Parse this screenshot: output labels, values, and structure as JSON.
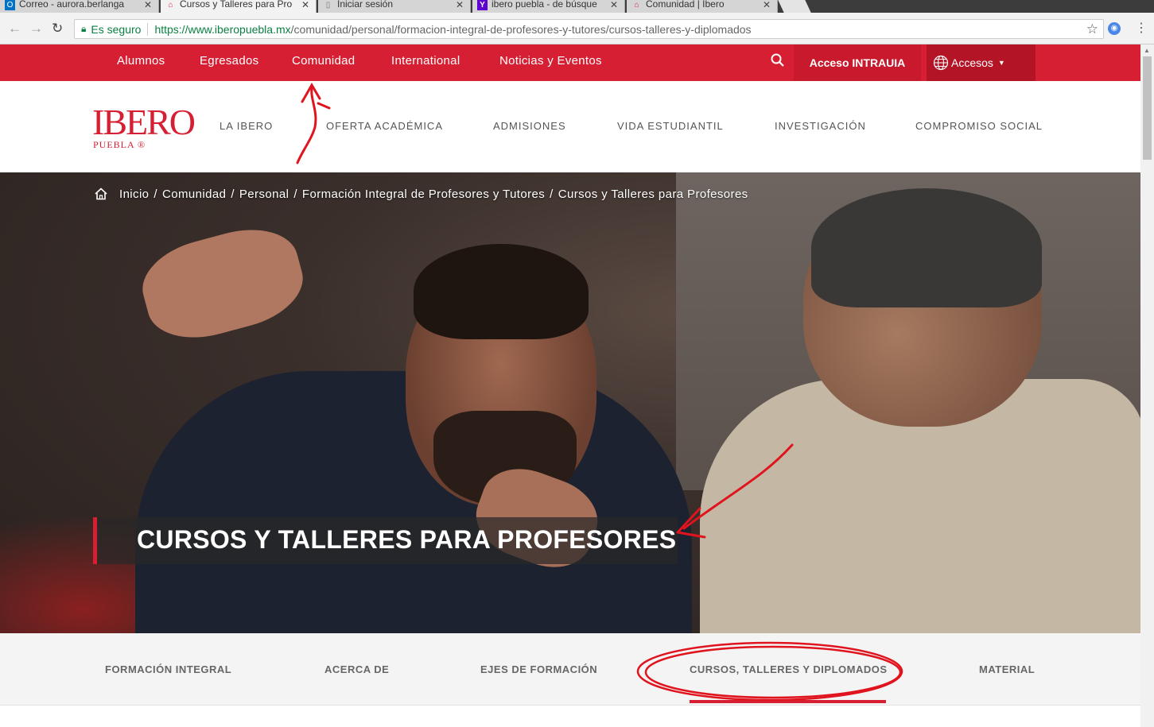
{
  "browser": {
    "tabs": [
      {
        "title": "Correo - aurora.berlanga",
        "icon": "outlook-icon"
      },
      {
        "title": "Cursos y Talleres para Pro",
        "icon": "ibero-icon"
      },
      {
        "title": "Iniciar sesión",
        "icon": "page-icon"
      },
      {
        "title": "ibero puebla - de búsque",
        "icon": "yahoo-icon"
      },
      {
        "title": "Comunidad | Ibero",
        "icon": "ibero-icon"
      }
    ],
    "secure_label": "Es seguro",
    "url_host": "https://www.iberopuebla.mx",
    "url_path": "/comunidad/personal/formacion-integral-de-profesores-y-tutores/cursos-talleres-y-diplomados"
  },
  "topbar": {
    "links": [
      "Alumnos",
      "Egresados",
      "Comunidad",
      "International",
      "Noticias y Eventos"
    ],
    "acceso": "Acceso INTRAUIA",
    "accesos": "Accesos"
  },
  "logo": {
    "main": "IBERO",
    "sub": "PUEBLA ®"
  },
  "mainnav": [
    "LA IBERO",
    "OFERTA ACADÉMICA",
    "ADMISIONES",
    "VIDA ESTUDIANTIL",
    "INVESTIGACIÓN",
    "COMPROMISO SOCIAL"
  ],
  "breadcrumb": [
    "Inicio",
    "Comunidad",
    "Personal",
    "Formación Integral de Profesores y Tutores",
    "Cursos y Talleres para Profesores"
  ],
  "hero_title": "CURSOS Y TALLERES PARA PROFESORES",
  "subnav": [
    "FORMACIÓN INTEGRAL",
    "ACERCA DE",
    "EJES DE FORMACIÓN",
    "CURSOS, TALLERES Y DIPLOMADOS",
    "MATERIAL"
  ],
  "colors": {
    "brand_red": "#d71f33",
    "annotation_red": "#e0141e"
  }
}
